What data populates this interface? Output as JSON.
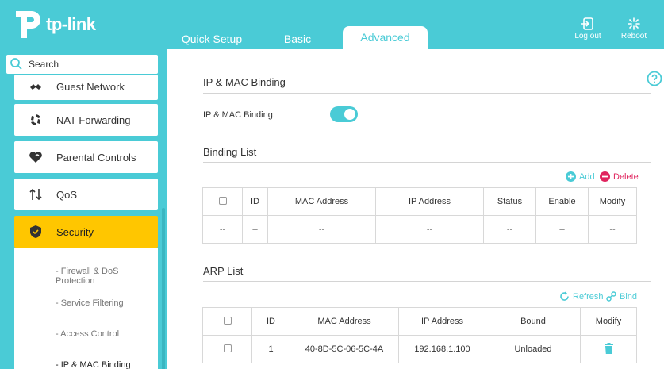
{
  "header": {
    "brand": "tp-link",
    "tabs": [
      {
        "label": "Quick Setup"
      },
      {
        "label": "Basic"
      },
      {
        "label": "Advanced"
      }
    ],
    "logout_label": "Log out",
    "reboot_label": "Reboot"
  },
  "sidebar": {
    "search_placeholder": "Search",
    "items": [
      {
        "label": "Guest Network",
        "icon": "guest-network-icon"
      },
      {
        "label": "NAT Forwarding",
        "icon": "nat-forwarding-icon"
      },
      {
        "label": "Parental Controls",
        "icon": "heart-icon"
      },
      {
        "label": "QoS",
        "icon": "arrows-updown-icon"
      },
      {
        "label": "Security",
        "icon": "shield-icon"
      }
    ],
    "subitems": [
      {
        "label": "- Firewall & DoS Protection"
      },
      {
        "label": "- Service Filtering"
      },
      {
        "label": "- Access Control"
      },
      {
        "label": "- IP & MAC Binding"
      }
    ]
  },
  "main": {
    "section_title": "IP & MAC Binding",
    "toggle_label": "IP & MAC Binding:",
    "toggle_on": true,
    "binding_list": {
      "title": "Binding List",
      "add_label": "Add",
      "delete_label": "Delete",
      "columns": [
        "ID",
        "MAC Address",
        "IP Address",
        "Status",
        "Enable",
        "Modify"
      ],
      "row": {
        "cb": "--",
        "id": "--",
        "mac": "--",
        "ip": "--",
        "status": "--",
        "enable": "--",
        "modify": "--"
      }
    },
    "arp_list": {
      "title": "ARP List",
      "refresh_label": "Refresh",
      "bind_label": "Bind",
      "columns": [
        "ID",
        "MAC Address",
        "IP Address",
        "Bound",
        "Modify"
      ],
      "row": {
        "id": "1",
        "mac": "40-8D-5C-06-5C-4A",
        "ip": "192.168.1.100",
        "bound": "Unloaded"
      }
    }
  },
  "colors": {
    "accent": "#4acbd6",
    "active": "#ffc600",
    "delete": "#e0245e"
  }
}
